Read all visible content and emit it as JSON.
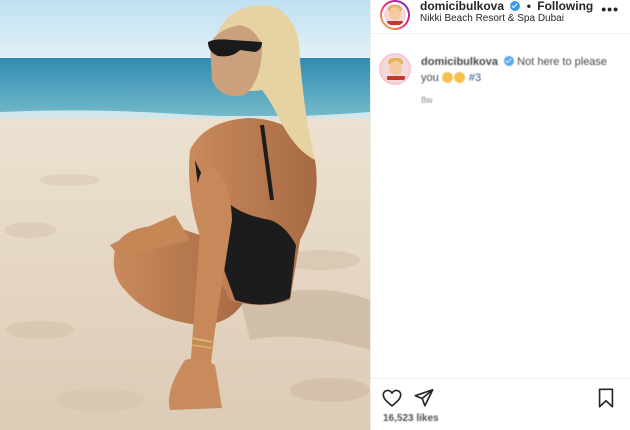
{
  "post": {
    "username": "domicibulkova",
    "separator": "•",
    "follow_status": "Following",
    "location": "Nikki Beach Resort & Spa Dubai",
    "more_label": "•••"
  },
  "comment": {
    "username": "domicibulkova",
    "text": "Not here to please you",
    "hashtag": "#3",
    "time": "8w"
  },
  "actions": {
    "likes": "16,523 likes"
  },
  "icons": {
    "verified": "verified-badge-icon",
    "like": "heart-icon",
    "share": "paper-plane-icon",
    "save": "bookmark-icon",
    "more": "ellipsis-icon"
  },
  "colors": {
    "verified": "#3897f0",
    "text": "#262626",
    "muted": "#8e8e8e",
    "border": "#efefef"
  }
}
